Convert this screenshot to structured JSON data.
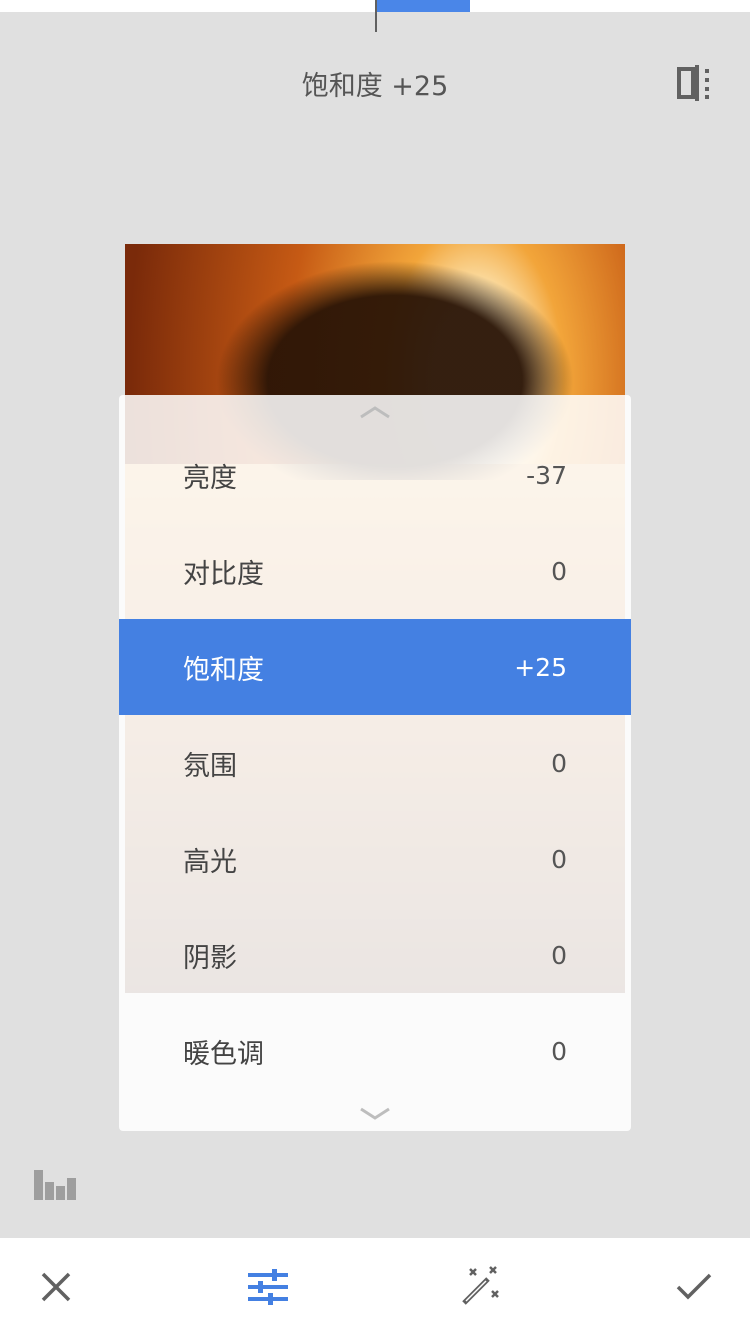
{
  "header": {
    "title": "饱和度 +25",
    "compare_icon": "compare-split-icon"
  },
  "adjustments": {
    "items": [
      {
        "label": "亮度",
        "value": "-37"
      },
      {
        "label": "对比度",
        "value": "0"
      },
      {
        "label": "饱和度",
        "value": "+25"
      },
      {
        "label": "氛围",
        "value": "0"
      },
      {
        "label": "高光",
        "value": "0"
      },
      {
        "label": "阴影",
        "value": "0"
      },
      {
        "label": "暖色调",
        "value": "0"
      }
    ],
    "selected_index": 2
  },
  "toolbar": {
    "cancel_icon": "close-icon",
    "tune_icon": "tune-sliders-icon",
    "auto_icon": "magic-wand-icon",
    "apply_icon": "checkmark-icon"
  },
  "histogram_icon": "histogram-icon",
  "colors": {
    "accent": "#4480e2",
    "background": "#e0e0e0"
  }
}
